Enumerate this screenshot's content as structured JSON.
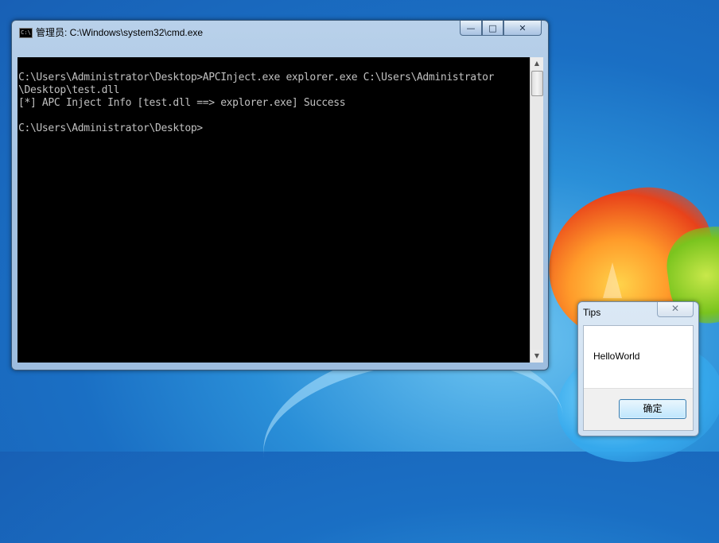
{
  "console_window": {
    "title": "管理员: C:\\Windows\\system32\\cmd.exe",
    "app_icon_text": "C:\\",
    "controls": {
      "minimize": "—",
      "maximize": "□",
      "close": "✕"
    },
    "lines": [
      "",
      "C:\\Users\\Administrator\\Desktop>APCInject.exe explorer.exe C:\\Users\\Administrator",
      "\\Desktop\\test.dll",
      "[*] APC Inject Info [test.dll ==> explorer.exe] Success",
      "",
      "C:\\Users\\Administrator\\Desktop>"
    ],
    "scrollbar": {
      "up_arrow": "▲",
      "down_arrow": "▼"
    }
  },
  "message_box": {
    "title": "Tips",
    "close": "✕",
    "message": "HelloWorld",
    "ok_button": "确定"
  }
}
